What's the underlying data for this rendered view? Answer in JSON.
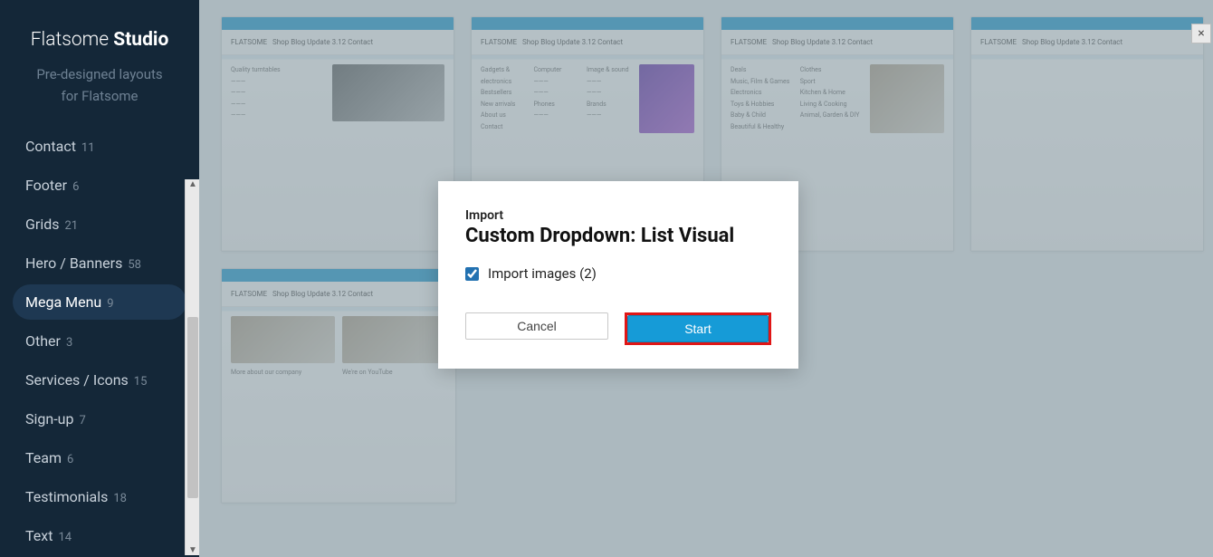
{
  "brand": {
    "thin": "Flatsome ",
    "bold": "Studio"
  },
  "tagline_l1": "Pre-designed layouts",
  "tagline_l2": "for Flatsome",
  "nav": [
    {
      "label": "Contact",
      "count": "11",
      "active": false
    },
    {
      "label": "Footer",
      "count": "6",
      "active": false
    },
    {
      "label": "Grids",
      "count": "21",
      "active": false
    },
    {
      "label": "Hero / Banners",
      "count": "58",
      "active": false
    },
    {
      "label": "Mega Menu",
      "count": "9",
      "active": true
    },
    {
      "label": "Other",
      "count": "3",
      "active": false
    },
    {
      "label": "Services / Icons",
      "count": "15",
      "active": false
    },
    {
      "label": "Sign-up",
      "count": "7",
      "active": false
    },
    {
      "label": "Team",
      "count": "6",
      "active": false
    },
    {
      "label": "Testimonials",
      "count": "18",
      "active": false
    },
    {
      "label": "Text",
      "count": "14",
      "active": false
    }
  ],
  "thumb_header": {
    "logo": "FLATSOME",
    "menu": "Shop   Blog   Update 3.12   Contact"
  },
  "close_glyph": "×",
  "modal": {
    "eyebrow": "Import",
    "title": "Custom Dropdown: List Visual",
    "checkbox_label": "Import images (2)",
    "checkbox_checked": true,
    "cancel": "Cancel",
    "start": "Start"
  }
}
